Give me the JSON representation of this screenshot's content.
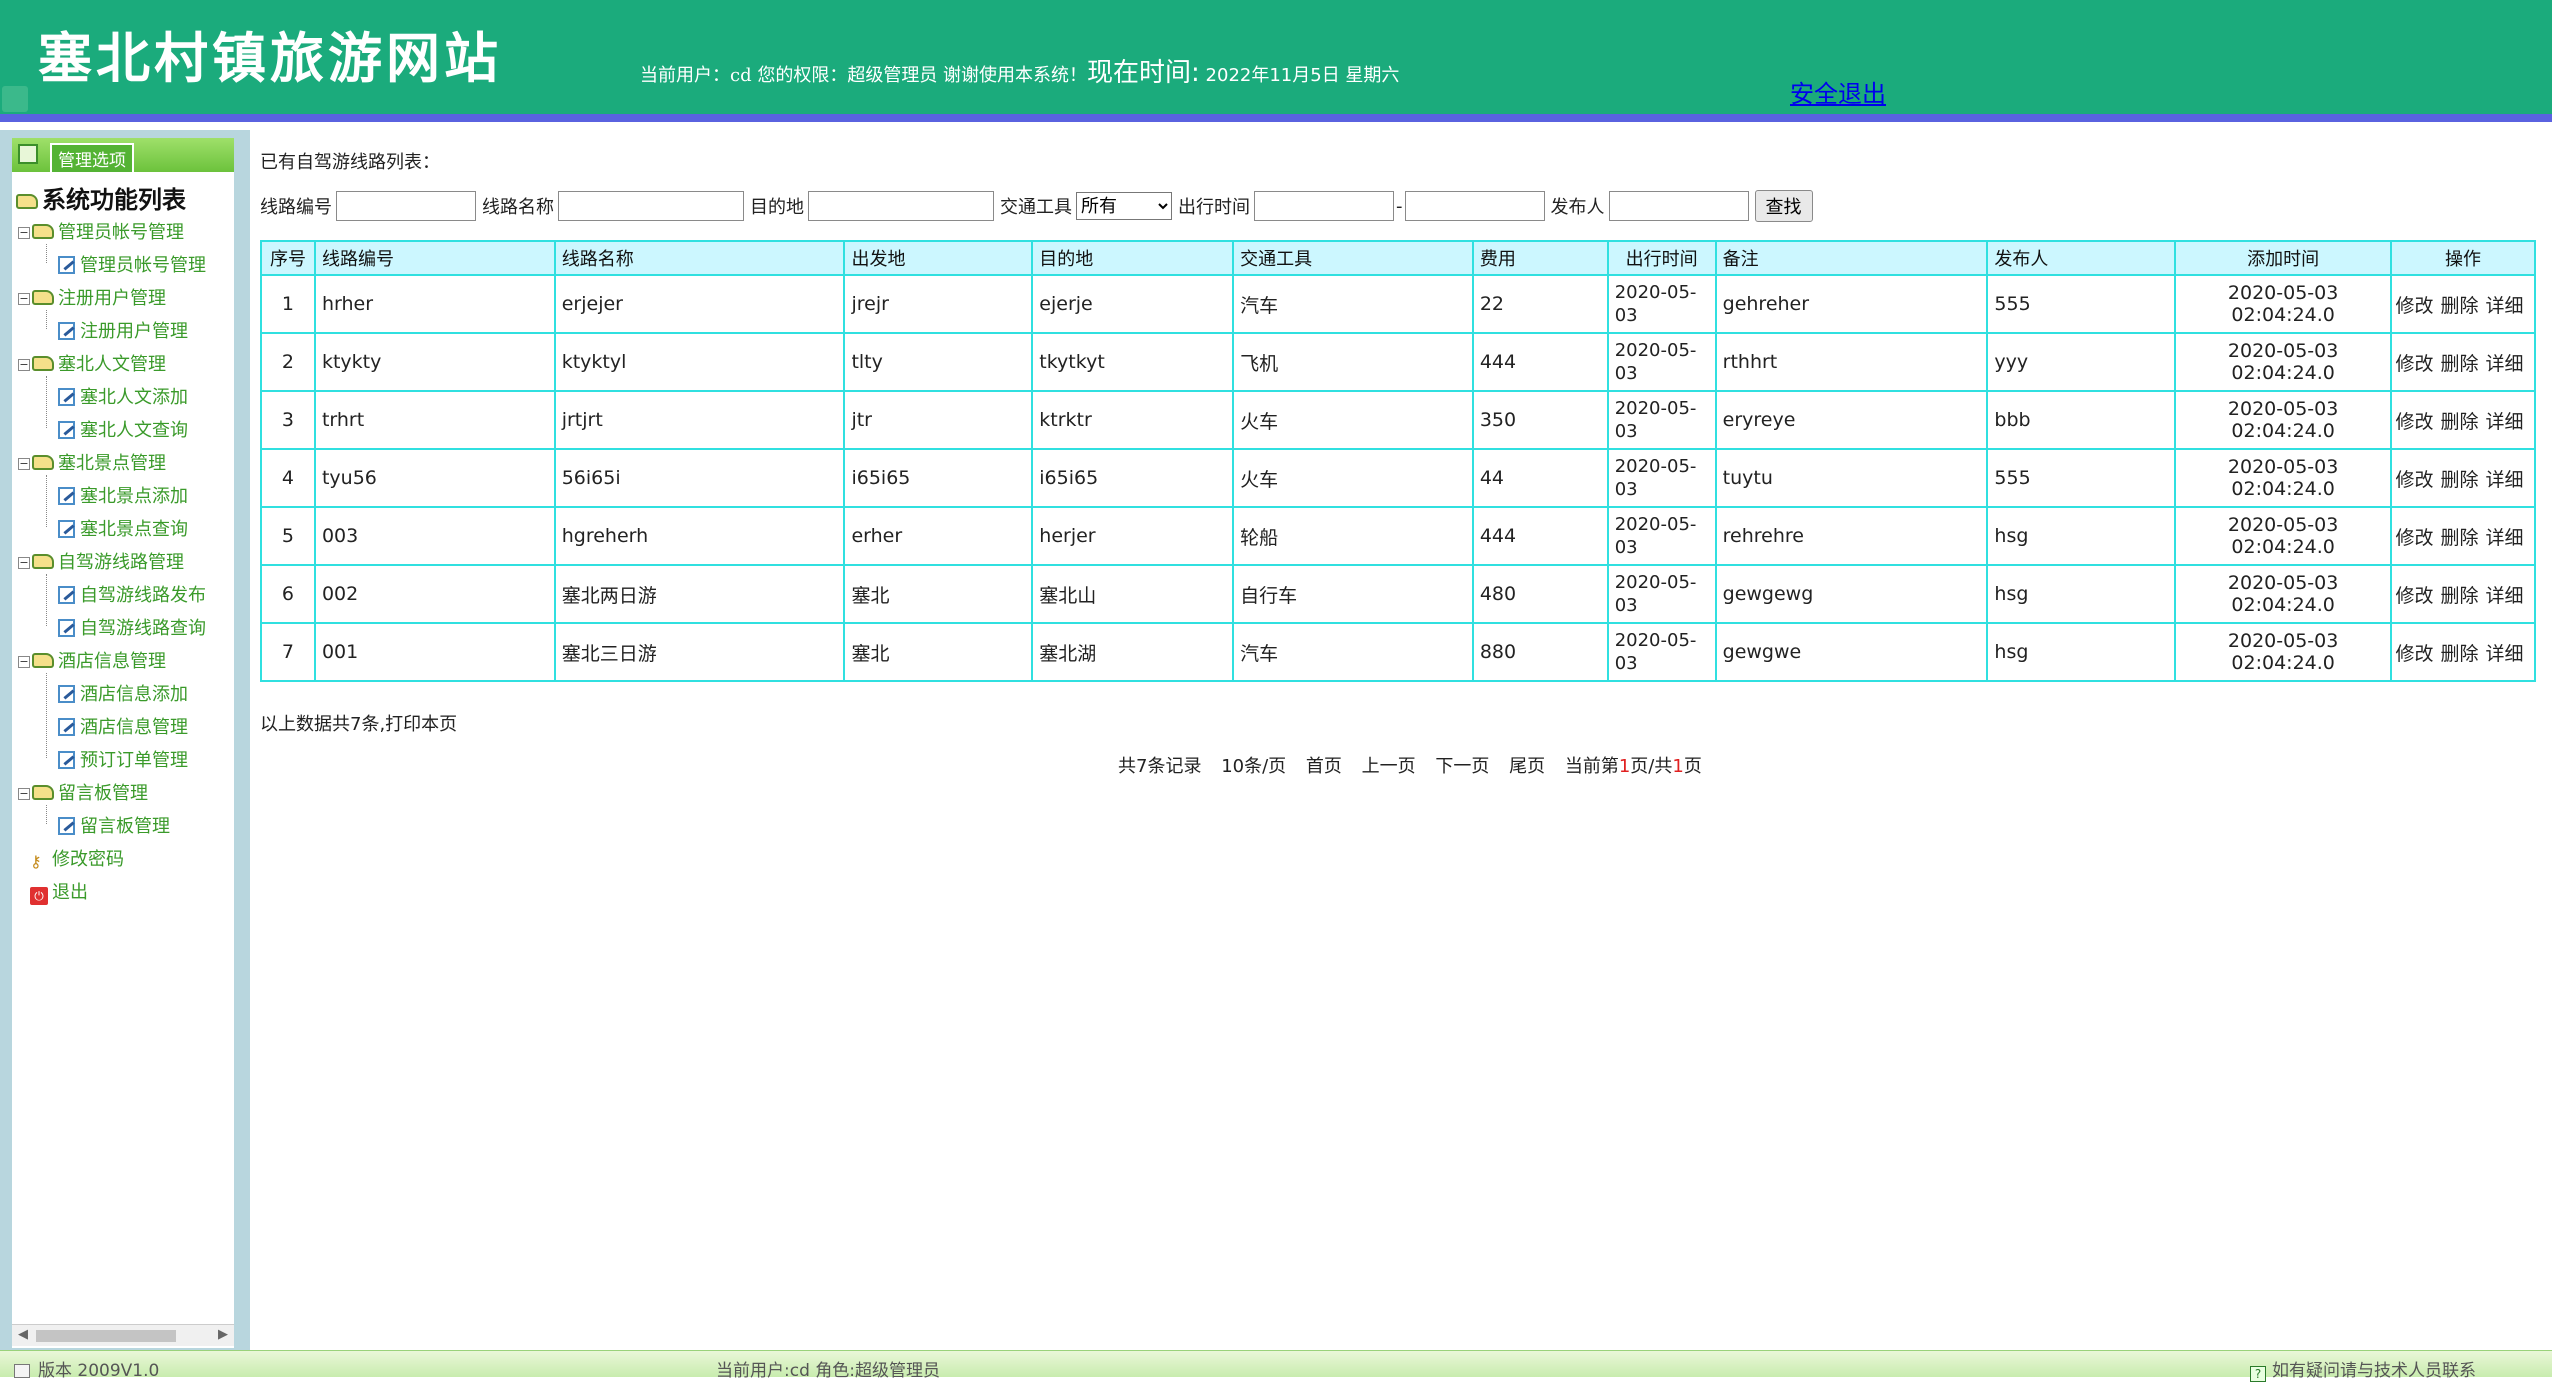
{
  "header": {
    "site_title": "塞北村镇旅游网站",
    "user_info": "当前用户：cd 您的权限：超级管理员 谢谢使用本系统！",
    "now_label": "现在时间:",
    "now_value": "2022年11月5日 星期六",
    "logout_label": "安全退出"
  },
  "sidebar": {
    "head_label": "管理选项",
    "tree_title": "系统功能列表",
    "groups": [
      {
        "label": "管理员帐号管理",
        "children": [
          "管理员帐号管理"
        ]
      },
      {
        "label": "注册用户管理",
        "children": [
          "注册用户管理"
        ]
      },
      {
        "label": "塞北人文管理",
        "children": [
          "塞北人文添加",
          "塞北人文查询"
        ]
      },
      {
        "label": "塞北景点管理",
        "children": [
          "塞北景点添加",
          "塞北景点查询"
        ]
      },
      {
        "label": "自驾游线路管理",
        "children": [
          "自驾游线路发布",
          "自驾游线路查询"
        ]
      },
      {
        "label": "酒店信息管理",
        "children": [
          "酒店信息添加",
          "酒店信息管理",
          "预订订单管理"
        ]
      },
      {
        "label": "留言板管理",
        "children": [
          "留言板管理"
        ]
      }
    ],
    "change_password": "修改密码",
    "exit": "退出"
  },
  "main": {
    "list_heading": "已有自驾游线路列表：",
    "search": {
      "route_no_label": "线路编号",
      "route_name_label": "线路名称",
      "destination_label": "目的地",
      "transport_label": "交通工具",
      "transport_selected": "所有",
      "depart_time_label": "出行时间",
      "range_dash": "-",
      "publisher_label": "发布人",
      "search_button": "查找"
    },
    "table": {
      "headers": [
        "序号",
        "线路编号",
        "线路名称",
        "出发地",
        "目的地",
        "交通工具",
        "费用",
        "出行时间",
        "备注",
        "发布人",
        "添加时间",
        "操作"
      ],
      "rows": [
        {
          "no": "1",
          "code": "hrher",
          "name": "erjejer",
          "from": "jrejr",
          "to": "ejerje",
          "transport": "汽车",
          "cost": "22",
          "date": "2020-05-03",
          "note": "gehreher",
          "publisher": "555",
          "added": "2020-05-03 02:04:24.0"
        },
        {
          "no": "2",
          "code": "ktykty",
          "name": "ktyktyl",
          "from": "tlty",
          "to": "tkytkyt",
          "transport": "飞机",
          "cost": "444",
          "date": "2020-05-03",
          "note": "rthhrt",
          "publisher": "yyy",
          "added": "2020-05-03 02:04:24.0"
        },
        {
          "no": "3",
          "code": "trhrt",
          "name": "jrtjrt",
          "from": "jtr",
          "to": "ktrktr",
          "transport": "火车",
          "cost": "350",
          "date": "2020-05-03",
          "note": "eryreye",
          "publisher": "bbb",
          "added": "2020-05-03 02:04:24.0"
        },
        {
          "no": "4",
          "code": "tyu56",
          "name": "56i65i",
          "from": "i65i65",
          "to": "i65i65",
          "transport": "火车",
          "cost": "44",
          "date": "2020-05-03",
          "note": "tuytu",
          "publisher": "555",
          "added": "2020-05-03 02:04:24.0"
        },
        {
          "no": "5",
          "code": "003",
          "name": "hgreherh",
          "from": "erher",
          "to": "herjer",
          "transport": "轮船",
          "cost": "444",
          "date": "2020-05-03",
          "note": "rehrehre",
          "publisher": "hsg",
          "added": "2020-05-03 02:04:24.0"
        },
        {
          "no": "6",
          "code": "002",
          "name": "塞北两日游",
          "from": "塞北",
          "to": "塞北山",
          "transport": "自行车",
          "cost": "480",
          "date": "2020-05-03",
          "note": "gewgewg",
          "publisher": "hsg",
          "added": "2020-05-03 02:04:24.0"
        },
        {
          "no": "7",
          "code": "001",
          "name": "塞北三日游",
          "from": "塞北",
          "to": "塞北湖",
          "transport": "汽车",
          "cost": "880",
          "date": "2020-05-03",
          "note": "gewgwe",
          "publisher": "hsg",
          "added": "2020-05-03 02:04:24.0"
        }
      ],
      "ops": [
        "修改",
        "删除",
        "详细"
      ]
    },
    "summary": "以上数据共7条,打印本页",
    "pagination": {
      "total": "共7条记录",
      "per_page": "10条/页",
      "first": "首页",
      "prev": "上一页",
      "next": "下一页",
      "last": "尾页",
      "current_prefix": "当前第",
      "current_page": "1",
      "current_mid": "页/共",
      "total_pages": "1",
      "current_suffix": "页"
    }
  },
  "footer": {
    "version": "版本 2009V1.0",
    "user_role": "当前用户:cd  角色:超级管理员",
    "contact": "如有疑问请与技术人员联系"
  }
}
